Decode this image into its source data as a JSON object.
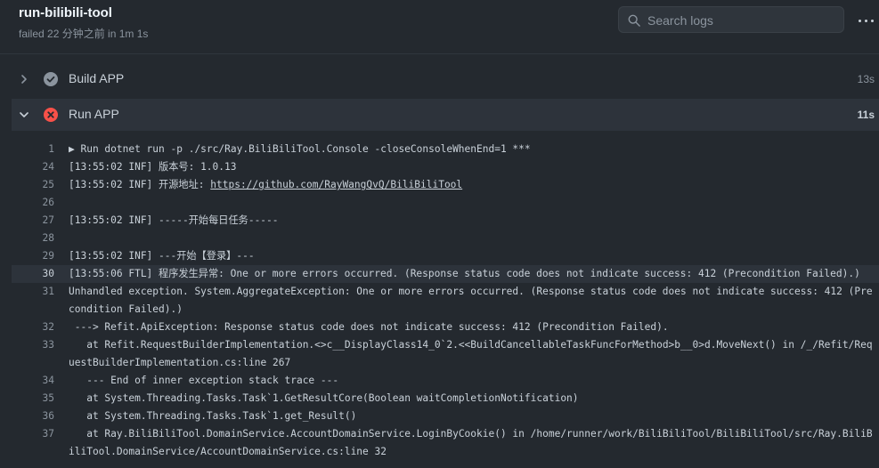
{
  "header": {
    "title": "run-bilibili-tool",
    "subtitle": "failed 22 分钟之前 in 1m 1s",
    "search_placeholder": "Search logs"
  },
  "steps": [
    {
      "name": "Build APP",
      "duration": "13s",
      "status": "success",
      "expanded": false
    },
    {
      "name": "Run APP",
      "duration": "11s",
      "status": "failed",
      "expanded": true
    }
  ],
  "log_lines": [
    {
      "num": "1",
      "text": "▶ Run dotnet run -p ./src/Ray.BiliBiliTool.Console -closeConsoleWhenEnd=1 ***"
    },
    {
      "num": "24",
      "text": "[13:55:02 INF] 版本号: 1.0.13"
    },
    {
      "num": "25",
      "text": "[13:55:02 INF] 开源地址: ",
      "link": "https://github.com/RayWangQvQ/BiliBiliTool"
    },
    {
      "num": "26",
      "text": ""
    },
    {
      "num": "27",
      "text": "[13:55:02 INF] -----开始每日任务-----"
    },
    {
      "num": "28",
      "text": ""
    },
    {
      "num": "29",
      "text": "[13:55:02 INF] ---开始【登录】---"
    },
    {
      "num": "30",
      "text": "[13:55:06 FTL] 程序发生异常: One or more errors occurred. (Response status code does not indicate success: 412 (Precondition Failed).)"
    },
    {
      "num": "31",
      "text": "Unhandled exception. System.AggregateException: One or more errors occurred. (Response status code does not indicate success: 412 (Precondition Failed).)"
    },
    {
      "num": "32",
      "text": " ---> Refit.ApiException: Response status code does not indicate success: 412 (Precondition Failed)."
    },
    {
      "num": "33",
      "text": "   at Refit.RequestBuilderImplementation.<>c__DisplayClass14_0`2.<<BuildCancellableTaskFuncForMethod>b__0>d.MoveNext() in /_/Refit/RequestBuilderImplementation.cs:line 267"
    },
    {
      "num": "34",
      "text": "   --- End of inner exception stack trace ---"
    },
    {
      "num": "35",
      "text": "   at System.Threading.Tasks.Task`1.GetResultCore(Boolean waitCompletionNotification)"
    },
    {
      "num": "36",
      "text": "   at System.Threading.Tasks.Task`1.get_Result()"
    },
    {
      "num": "37",
      "text": "   at Ray.BiliBiliTool.DomainService.AccountDomainService.LoginByCookie() in /home/runner/work/BiliBiliTool/BiliBiliTool/src/Ray.BiliBiliTool.DomainService/AccountDomainService.cs:line 32"
    }
  ],
  "colors": {
    "success": "#8b949e",
    "failed": "#f85149",
    "background": "#24292f"
  }
}
